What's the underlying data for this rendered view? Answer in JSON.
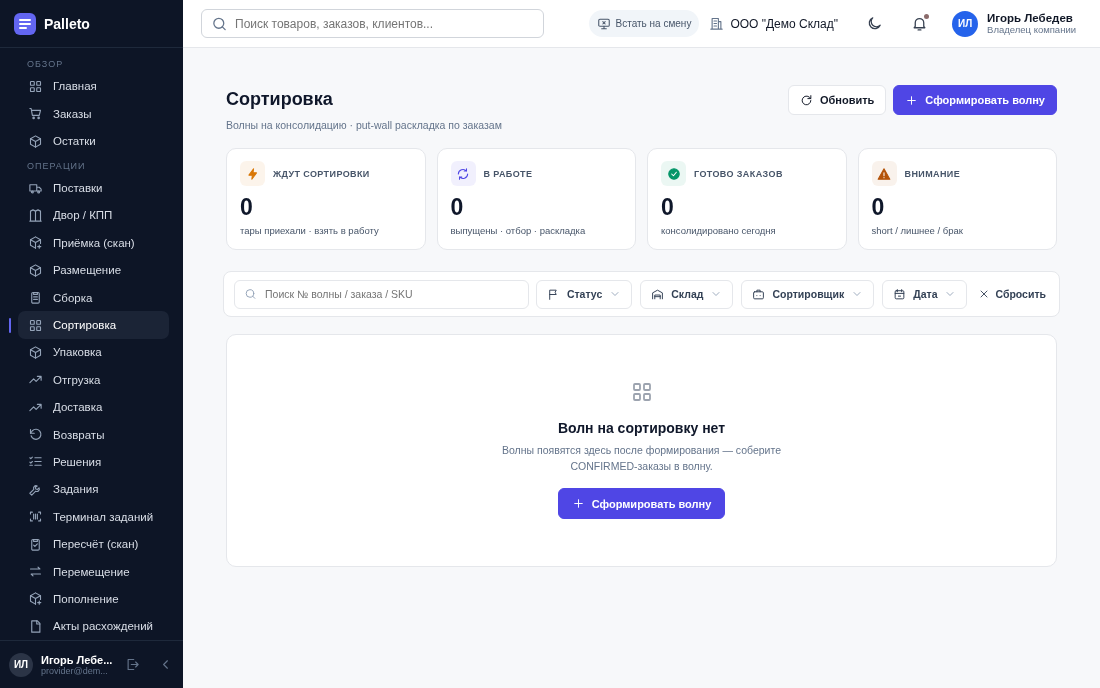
{
  "app": {
    "name": "Palleto"
  },
  "sidebar": {
    "sections": [
      {
        "label": "ОБЗОР",
        "items": [
          {
            "label": "Главная",
            "selected": false
          },
          {
            "label": "Заказы",
            "selected": false
          },
          {
            "label": "Остатки",
            "selected": false
          }
        ]
      },
      {
        "label": "ОПЕРАЦИИ",
        "items": [
          {
            "label": "Поставки",
            "selected": false
          },
          {
            "label": "Двор / КПП",
            "selected": false
          },
          {
            "label": "Приёмка (скан)",
            "selected": false
          },
          {
            "label": "Размещение",
            "selected": false
          },
          {
            "label": "Сборка",
            "selected": false
          },
          {
            "label": "Сортировка",
            "selected": true
          },
          {
            "label": "Упаковка",
            "selected": false
          },
          {
            "label": "Отгрузка",
            "selected": false
          },
          {
            "label": "Доставка",
            "selected": false
          },
          {
            "label": "Возвраты",
            "selected": false
          },
          {
            "label": "Решения",
            "selected": false
          },
          {
            "label": "Задания",
            "selected": false
          },
          {
            "label": "Терминал заданий",
            "selected": false
          },
          {
            "label": "Пересчёт (скан)",
            "selected": false
          },
          {
            "label": "Перемещение",
            "selected": false
          },
          {
            "label": "Пополнение",
            "selected": false
          },
          {
            "label": "Акты расхождений",
            "selected": false
          }
        ]
      }
    ],
    "user": {
      "initials": "ИЛ",
      "name": "Игорь Лебе...",
      "email": "provider@dem..."
    }
  },
  "topbar": {
    "search": {
      "placeholder": "Поиск товаров, заказов, клиентов..."
    },
    "shift_button": "Встать на смену",
    "company": "ООО \"Демо Склад\"",
    "notifications": {
      "unread": true
    },
    "user": {
      "initials": "ИЛ",
      "name": "Игорь Лебедев",
      "role": "Владелец компании"
    }
  },
  "page": {
    "title": "Сортировка",
    "subtitle": "Волны на консолидацию · put-wall раскладка по заказам",
    "actions": [
      "Обновить",
      "Сформировать волну"
    ]
  },
  "stats": [
    {
      "label": "ЖДУТ СОРТИРОВКИ",
      "value": "0",
      "note": "тары приехали · взять в работу",
      "color": "#d97706"
    },
    {
      "label": "В РАБОТЕ",
      "value": "0",
      "note": "выпущены · отбор · раскладка",
      "color": "#4f46e5"
    },
    {
      "label": "ГОТОВО ЗАКАЗОВ",
      "value": "0",
      "note": "консолидировано сегодня",
      "color": "#059669"
    },
    {
      "label": "ВНИМАНИЕ",
      "value": "0",
      "note": "short / лишнее / брак",
      "color": "#b45309"
    }
  ],
  "filters": {
    "search": {
      "placeholder": "Поиск № волны / заказа / SKU"
    },
    "dropdowns": [
      "Статус",
      "Склад",
      "Сортировщик",
      "Дата"
    ],
    "reset": "Сбросить"
  },
  "empty_state": {
    "title": "Волн на сортировку нет",
    "text": "Волны появятся здесь после формирования — соберите CONFIRMED-заказы в волну.",
    "button": "Сформировать волну"
  }
}
